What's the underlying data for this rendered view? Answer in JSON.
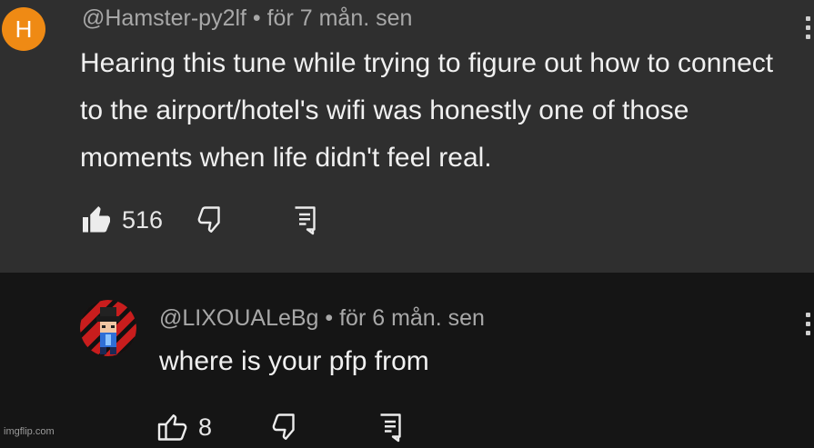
{
  "comments": [
    {
      "avatar_letter": "H",
      "avatar_color": "#ef8a14",
      "meta": "@Hamster-py2lf • för 7 mån. sen",
      "text": "Hearing this tune while trying to figure out how to connect to the airport/hotel's wifi was honestly one of those moments when life didn't feel real.",
      "like_count": "516",
      "like_icon": "thumbs-up-filled-icon",
      "dislike_icon": "thumbs-down-icon",
      "reply_icon": "reply-icon"
    },
    {
      "avatar_icon": "pixel-character-avatar",
      "meta": "@LIXOUALeBg • för 6 mån. sen",
      "text": "where is your pfp from",
      "like_count": "8",
      "like_icon": "thumbs-up-icon",
      "dislike_icon": "thumbs-down-icon",
      "reply_icon": "reply-icon"
    }
  ],
  "watermark": "imgflip.com"
}
